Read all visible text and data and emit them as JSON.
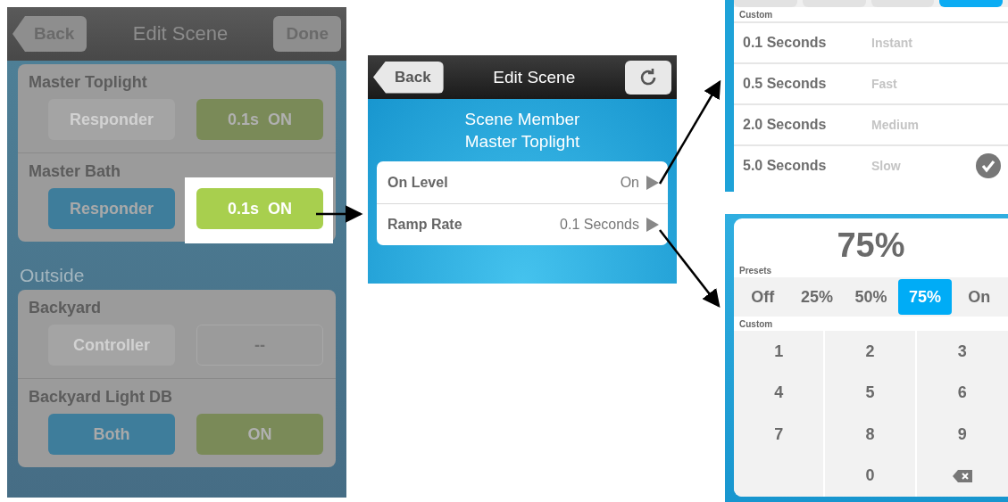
{
  "scene_list": {
    "header": {
      "back": "Back",
      "title": "Edit Scene",
      "done": "Done"
    },
    "groups": [
      {
        "cards": [
          {
            "name": "Master Toplight",
            "buttons": [
              {
                "label": "Responder",
                "kind": "disabled",
                "highlighted": false
              },
              {
                "label": "0.1s  ON",
                "kind": "green",
                "highlighted": false
              }
            ]
          },
          {
            "name": "Master Bath",
            "buttons": [
              {
                "label": "Responder",
                "kind": "blue",
                "highlighted": false
              },
              {
                "label": "0.1s  ON",
                "kind": "green",
                "highlighted": true
              }
            ]
          }
        ]
      },
      {
        "title": "Outside",
        "cards": [
          {
            "name": "Backyard",
            "buttons": [
              {
                "label": "Controller",
                "kind": "disabled",
                "highlighted": false
              },
              {
                "label": "--",
                "kind": "outline",
                "highlighted": false
              }
            ]
          },
          {
            "name": "Backyard Light DB",
            "buttons": [
              {
                "label": "Both",
                "kind": "blue",
                "highlighted": false
              },
              {
                "label": "ON",
                "kind": "green",
                "highlighted": false
              }
            ]
          }
        ]
      }
    ]
  },
  "member": {
    "header": {
      "back": "Back",
      "title": "Edit Scene"
    },
    "title_lines": [
      "Scene Member",
      "Master Toplight"
    ],
    "rows": [
      {
        "label": "On Level",
        "value": "On"
      },
      {
        "label": "Ramp Rate",
        "value": "0.1 Seconds"
      }
    ]
  },
  "ramp_rate": {
    "segments": [
      {
        "selected": false
      },
      {
        "selected": false
      },
      {
        "selected": false
      },
      {
        "selected": true
      }
    ],
    "section": "Custom",
    "options": [
      {
        "value": "0.1 Seconds",
        "hint": "Instant",
        "checked": false
      },
      {
        "value": "0.5 Seconds",
        "hint": "Fast",
        "checked": false
      },
      {
        "value": "2.0 Seconds",
        "hint": "Medium",
        "checked": false
      },
      {
        "value": "5.0 Seconds",
        "hint": "Slow",
        "checked": true
      }
    ]
  },
  "on_level": {
    "display": "75%",
    "presets_label": "Presets",
    "presets": [
      {
        "label": "Off",
        "selected": false
      },
      {
        "label": "25%",
        "selected": false
      },
      {
        "label": "50%",
        "selected": false
      },
      {
        "label": "75%",
        "selected": true
      },
      {
        "label": "On",
        "selected": false
      }
    ],
    "custom_label": "Custom",
    "keys": [
      {
        "kind": "digit",
        "label": "1"
      },
      {
        "kind": "digit",
        "label": "2"
      },
      {
        "kind": "digit",
        "label": "3"
      },
      {
        "kind": "digit",
        "label": "4"
      },
      {
        "kind": "digit",
        "label": "5"
      },
      {
        "kind": "digit",
        "label": "6"
      },
      {
        "kind": "digit",
        "label": "7"
      },
      {
        "kind": "digit",
        "label": "8"
      },
      {
        "kind": "digit",
        "label": "9"
      },
      {
        "kind": "blank"
      },
      {
        "kind": "digit",
        "label": "0"
      },
      {
        "kind": "backspace"
      }
    ]
  }
}
